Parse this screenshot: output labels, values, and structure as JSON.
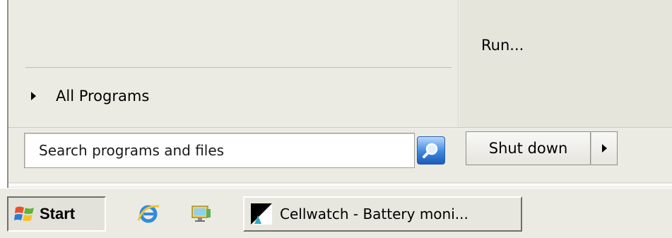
{
  "start_menu": {
    "all_programs_label": "All Programs",
    "run_label": "Run...",
    "search": {
      "placeholder": "Search programs and files",
      "button_icon": "search-icon"
    },
    "shutdown_label": "Shut down",
    "shutdown_options_icon": "triangle-right-icon"
  },
  "taskbar": {
    "start_label": "Start",
    "quick_launch": [
      {
        "name": "internet-explorer",
        "icon": "ie-icon"
      },
      {
        "name": "show-desktop",
        "icon": "desktop-icon"
      }
    ],
    "tasks": [
      {
        "label": "Cellwatch - Battery moni...",
        "icon": "cellwatch-icon"
      }
    ]
  },
  "colors": {
    "menu_bg": "#ecebe3",
    "right_pane_bg": "#e6e5dc",
    "search_button": "#3f86de"
  }
}
